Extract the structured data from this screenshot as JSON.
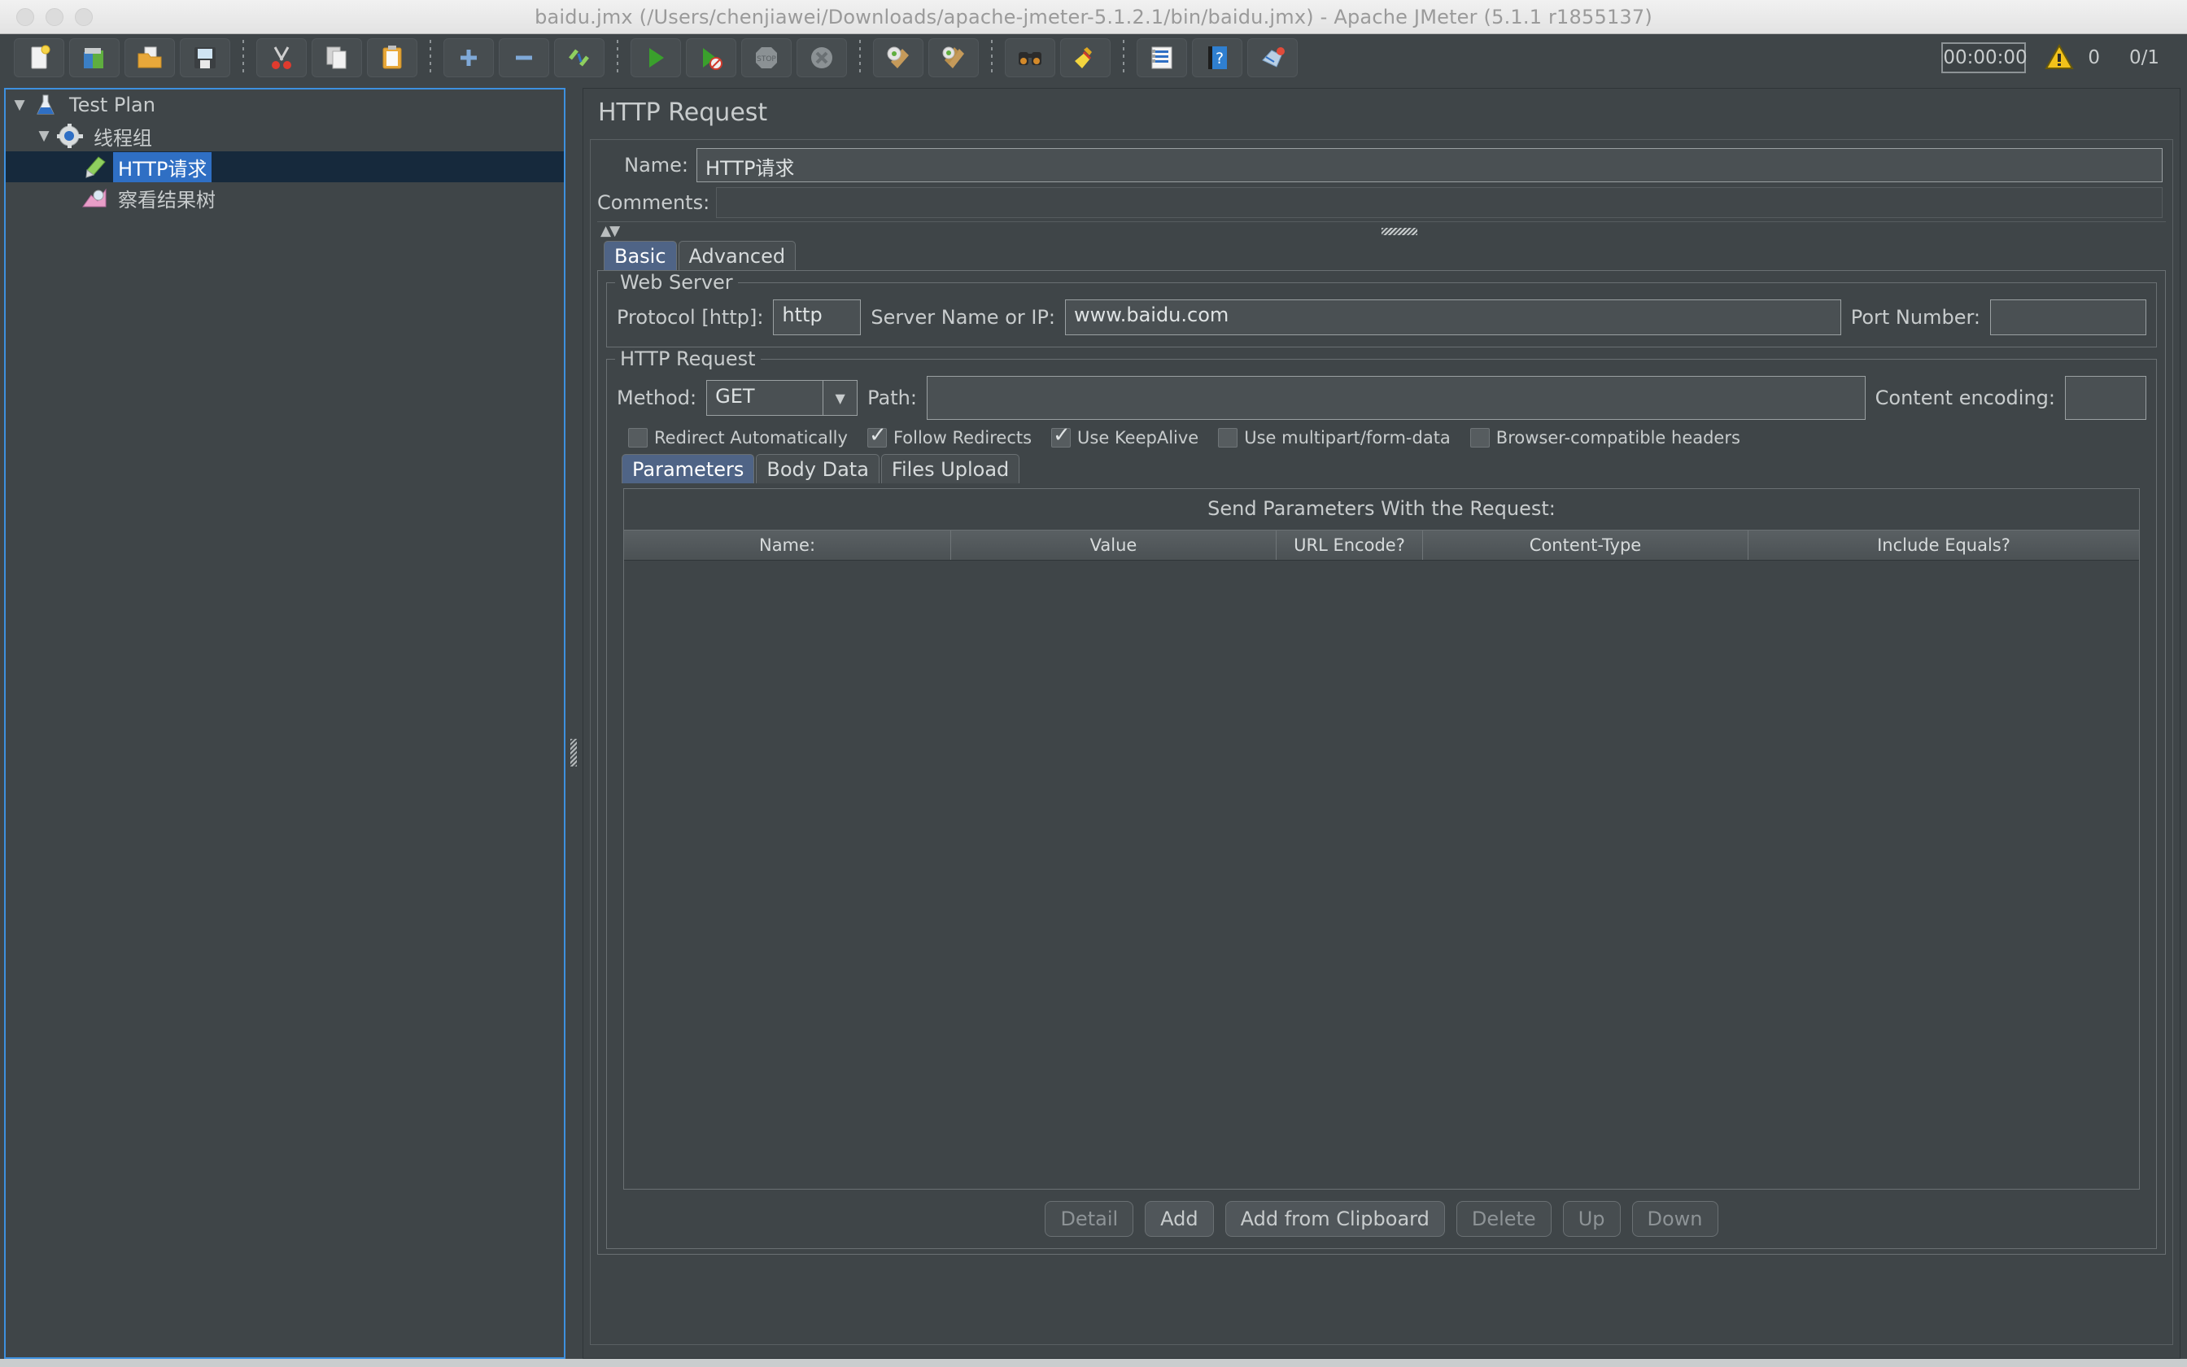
{
  "window": {
    "title": "baidu.jmx (/Users/chenjiawei/Downloads/apache-jmeter-5.1.2.1/bin/baidu.jmx) - Apache JMeter (5.1.1 r1855137)"
  },
  "toolbar": {
    "buttons": [
      {
        "name": "new-icon",
        "tooltip": "New"
      },
      {
        "name": "templates-icon",
        "tooltip": "Templates"
      },
      {
        "name": "open-icon",
        "tooltip": "Open"
      },
      {
        "name": "save-icon",
        "tooltip": "Save Test Plan"
      },
      {
        "name": "cut-icon",
        "tooltip": "Cut"
      },
      {
        "name": "copy-icon",
        "tooltip": "Copy"
      },
      {
        "name": "paste-icon",
        "tooltip": "Paste"
      },
      {
        "name": "expand-all-icon",
        "tooltip": "Expand All"
      },
      {
        "name": "collapse-all-icon",
        "tooltip": "Collapse All"
      },
      {
        "name": "toggle-icon",
        "tooltip": "Toggle"
      },
      {
        "name": "start-icon",
        "tooltip": "Start"
      },
      {
        "name": "start-no-pauses-icon",
        "tooltip": "Start no pauses"
      },
      {
        "name": "stop-icon",
        "tooltip": "Stop"
      },
      {
        "name": "shutdown-icon",
        "tooltip": "Shutdown"
      },
      {
        "name": "clear-icon",
        "tooltip": "Clear"
      },
      {
        "name": "clear-all-icon",
        "tooltip": "Clear All"
      },
      {
        "name": "search-icon",
        "tooltip": "Search"
      },
      {
        "name": "reset-search-icon",
        "tooltip": "Reset Search"
      },
      {
        "name": "function-helper-icon",
        "tooltip": "Function Helper Dialog"
      },
      {
        "name": "help-icon",
        "tooltip": "Help"
      },
      {
        "name": "undo-icon",
        "tooltip": "Undo"
      }
    ],
    "timer": "00:00:00",
    "warning_count": "0",
    "thread_count": "0/1"
  },
  "tree": {
    "nodes": [
      {
        "label": "Test Plan",
        "icon": "test-plan-icon",
        "indent": 0,
        "twisty": "▼",
        "selected": false
      },
      {
        "label": "线程组",
        "icon": "thread-group-icon",
        "indent": 1,
        "twisty": "▼",
        "selected": false
      },
      {
        "label": "HTTP请求",
        "icon": "http-sampler-icon",
        "indent": 2,
        "twisty": "",
        "selected": true
      },
      {
        "label": "察看结果树",
        "icon": "view-results-tree-icon",
        "indent": 2,
        "twisty": "",
        "selected": false
      }
    ]
  },
  "main": {
    "panel_title": "HTTP Request",
    "name_label": "Name:",
    "name_value": "HTTP请求",
    "comments_label": "Comments:",
    "comments_value": "",
    "tabs": [
      {
        "label": "Basic",
        "active": true
      },
      {
        "label": "Advanced",
        "active": false
      }
    ],
    "web_server": {
      "group_title": "Web Server",
      "protocol_label": "Protocol [http]:",
      "protocol_value": "http",
      "server_label": "Server Name or IP:",
      "server_value": "www.baidu.com",
      "port_label": "Port Number:",
      "port_value": ""
    },
    "http_request": {
      "group_title": "HTTP Request",
      "method_label": "Method:",
      "method_value": "GET",
      "path_label": "Path:",
      "path_value": "",
      "encoding_label": "Content encoding:",
      "encoding_value": "",
      "checkboxes": [
        {
          "label": "Redirect Automatically",
          "checked": false
        },
        {
          "label": "Follow Redirects",
          "checked": true
        },
        {
          "label": "Use KeepAlive",
          "checked": true
        },
        {
          "label": "Use multipart/form-data",
          "checked": false
        },
        {
          "label": "Browser-compatible headers",
          "checked": false
        }
      ]
    },
    "param_tabs": [
      {
        "label": "Parameters",
        "active": true
      },
      {
        "label": "Body Data",
        "active": false
      },
      {
        "label": "Files Upload",
        "active": false
      }
    ],
    "params_table": {
      "caption": "Send Parameters With the Request:",
      "columns": [
        "Name:",
        "Value",
        "URL Encode?",
        "Content-Type",
        "Include Equals?"
      ],
      "rows": []
    },
    "buttons": [
      {
        "label": "Detail",
        "state": "disabled"
      },
      {
        "label": "Add",
        "state": "highlight"
      },
      {
        "label": "Add from Clipboard",
        "state": "highlight"
      },
      {
        "label": "Delete",
        "state": "disabled"
      },
      {
        "label": "Up",
        "state": "disabled"
      },
      {
        "label": "Down",
        "state": "disabled"
      }
    ]
  },
  "colors": {
    "background": "#3f4548",
    "selection": "#2f6fc4",
    "selection_row": "#16293c",
    "accent_border": "#3d90df",
    "text": "#c8cccd",
    "tab_active": "#4f6486"
  }
}
